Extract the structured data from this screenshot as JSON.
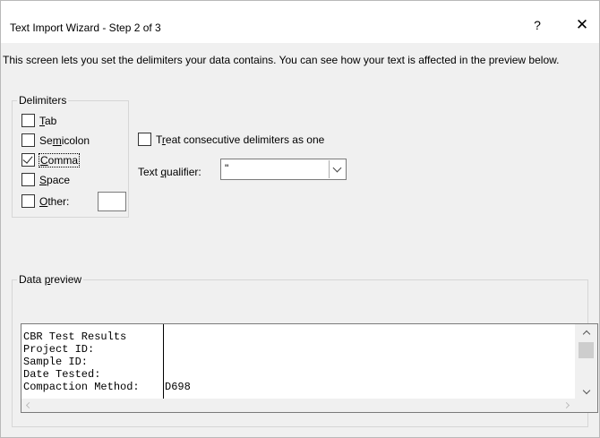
{
  "window": {
    "title": "Text Import Wizard - Step 2 of 3",
    "help_label": "?",
    "close_label": "✕"
  },
  "instructions": "This screen lets you set the delimiters your data contains.  You can see how your text is affected in the preview below.",
  "delimiters": {
    "group_label": "Delimiters",
    "tab": {
      "label_pre": "",
      "accel": "T",
      "label_post": "ab",
      "checked": false
    },
    "semicolon": {
      "label_pre": "Se",
      "accel": "m",
      "label_post": "icolon",
      "checked": false
    },
    "comma": {
      "label_pre": "",
      "accel": "C",
      "label_post": "omma",
      "checked": true
    },
    "space": {
      "label_pre": "",
      "accel": "S",
      "label_post": "pace",
      "checked": false
    },
    "other": {
      "label_pre": "",
      "accel": "O",
      "label_post": "ther:",
      "checked": false,
      "value": ""
    }
  },
  "treat_consecutive": {
    "label_pre": "T",
    "accel": "r",
    "label_post": "eat consecutive delimiters as one",
    "checked": false
  },
  "text_qualifier": {
    "label_pre": "Text ",
    "accel": "q",
    "label_post": "ualifier:",
    "value": "\""
  },
  "preview": {
    "group_label_pre": "Data ",
    "group_label_accel": "p",
    "group_label_post": "review",
    "column1": [
      "CBR Test Results",
      "Project ID:",
      "Sample ID:",
      "Date Tested:",
      "Compaction Method:"
    ],
    "column2": [
      "",
      "",
      "",
      "",
      "D698"
    ]
  }
}
